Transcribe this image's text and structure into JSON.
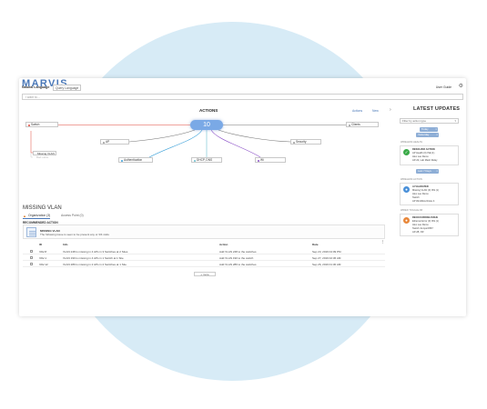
{
  "app": {
    "brand": "MARVIS",
    "natural_language_label": "Natural Language",
    "query_language_label": "Query Language",
    "user_guide_label": "User Guide",
    "search_placeholder": "I want to..."
  },
  "graph": {
    "title": "ACTIONS",
    "hub_count": "10",
    "actions_link": "Actions",
    "new_link": "New",
    "nodes": {
      "switch": "Switch",
      "ap": "AP",
      "clients": "Clients",
      "security": "Security",
      "authentication": "Authentication",
      "dhcp_dns": "DHCP, DNS",
      "wi": "Wi"
    },
    "sub_nodes": [
      "Missing VLAN",
      "Bad cable"
    ],
    "colors": {
      "switch": "#e0483b",
      "ap": "#9a9a9a",
      "clients": "#9a9a9a",
      "security": "#9a9a9a",
      "authentication": "#3aa0d8",
      "dhcp_dns": "#6cc0d0",
      "wi": "#8a4fc7",
      "hub": "#7aa9e6"
    }
  },
  "detail": {
    "title": "MISSING VLAN",
    "tab_org": "Organization (3)",
    "tab_ap": "Access Point (0)",
    "recommended_label": "RECOMMENDED ACTION",
    "rec_name": "MISSING VLAN",
    "rec_desc": "The following issue is seen to be present any or 3/4 visits",
    "columns": {
      "id": "ID",
      "info": "Info",
      "action": "Action",
      "date": "Date"
    },
    "rows": [
      {
        "id": "VAV-8",
        "info": "VLAN 248 is missing in 4 APs in 3 Switches at 2 Sites",
        "action": "Add VLAN 248 to the switches",
        "date": "Sep 23, 2019 04:09 PM"
      },
      {
        "id": "VAV-1",
        "info": "VLAN 190 is missing in 4 APs in 1 Switch at 1 Site",
        "action": "Add VLAN 190 to the switch",
        "date": "Sep 27, 2019 02:36 AM"
      },
      {
        "id": "VAV-12",
        "info": "VLAN 289 is missing in 2 APs in 2 Switches at 1 Site",
        "action": "Add VLAN 289 to the switches",
        "date": "Sep 26, 2019 01:30 AM"
      }
    ],
    "more_label": "+ more"
  },
  "updates": {
    "title": "LATEST UPDATES",
    "filter_placeholder": "Filter by action type",
    "pill_today": "Today",
    "pill_yesterday": "Yesterday",
    "pill_last7": "Last 7 Days",
    "cards": [
      {
        "category": "WIRELESS HEALTH",
        "heading": "RESOLVED ACTION",
        "line1": "AP Health (0) ISE (1)",
        "line2": "Alex Lee Remo",
        "line3": "AP-22, Lab Mesh Relay",
        "color": "#3aaa48",
        "icon": "check-icon"
      },
      {
        "category": "WIRELESS ACTION",
        "heading": "AI VALIDATED",
        "line1": "Missing VLAN (0) ISS (1)",
        "line2": "Alex Lee Remo",
        "line3": "Switch",
        "line4": "AP Workflow Rules 4",
        "color": "#4a90d9",
        "icon": "person-icon"
      },
      {
        "category": "WIRED TOGGLE AB",
        "heading": "REOCCURRING ISSUE",
        "line1": "Ethernet Error (0) ISS (1)",
        "line2": "Alex Lee Remo",
        "line3": "Switch Jumper4567",
        "line4": "AP-28, OR",
        "color": "#e8873a",
        "icon": "person-icon"
      }
    ]
  }
}
